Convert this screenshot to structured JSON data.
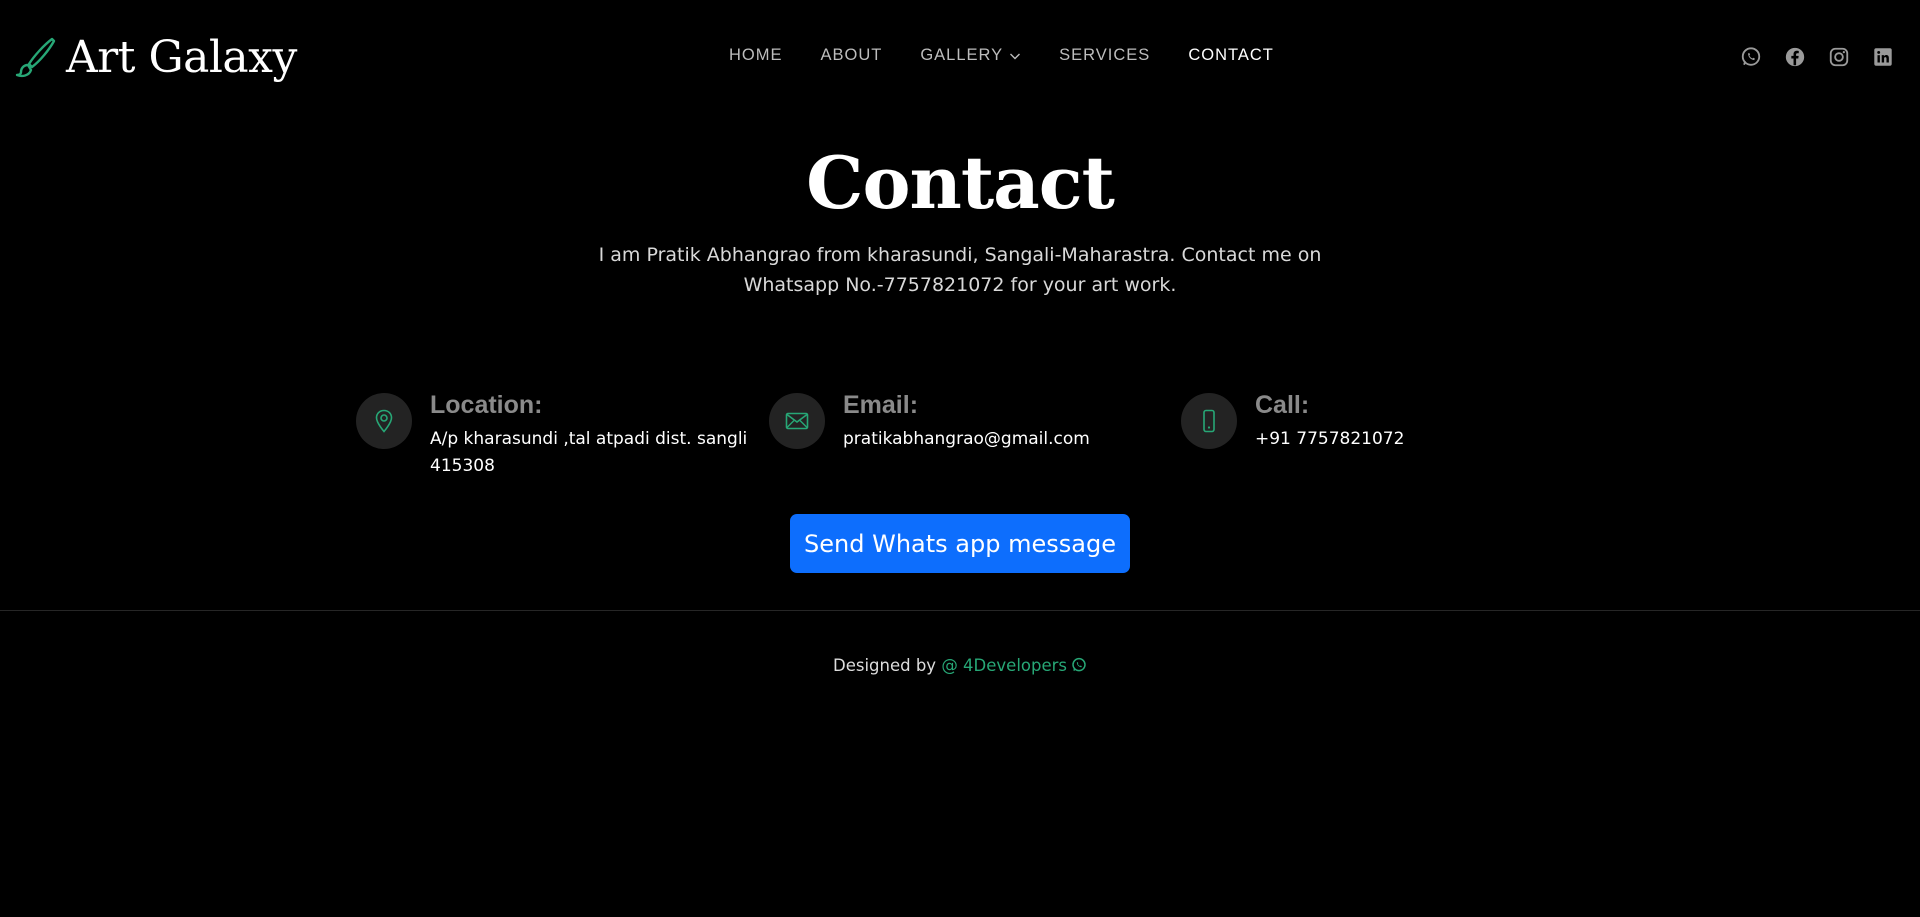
{
  "brand": {
    "name": "Art Galaxy",
    "accent": "#27a776"
  },
  "nav": {
    "items": [
      {
        "label": "HOME"
      },
      {
        "label": "ABOUT"
      },
      {
        "label": "GALLERY"
      },
      {
        "label": "SERVICES"
      },
      {
        "label": "CONTACT"
      }
    ],
    "active": "CONTACT"
  },
  "social": [
    "whatsapp-icon",
    "facebook-icon",
    "instagram-icon",
    "linkedin-icon"
  ],
  "page": {
    "title": "Contact",
    "description": "I am Pratik Abhangrao from kharasundi, Sangali-Maharastra. Contact me on Whatsapp No.-7757821072 for your art work."
  },
  "contact": {
    "location": {
      "label": "Location:",
      "value": "A/p kharasundi ,tal atpadi dist. sangli 415308",
      "icon": "map-pin-icon"
    },
    "email": {
      "label": "Email:",
      "value": "pratikabhangrao@gmail.com",
      "icon": "envelope-icon"
    },
    "call": {
      "label": "Call:",
      "value": "+91 7757821072",
      "icon": "phone-icon"
    }
  },
  "whatsapp_button": {
    "label": "Send Whats app message",
    "color": "#0d6efd"
  },
  "footer": {
    "prefix": "Designed by ",
    "developer": "@ 4Developers"
  }
}
